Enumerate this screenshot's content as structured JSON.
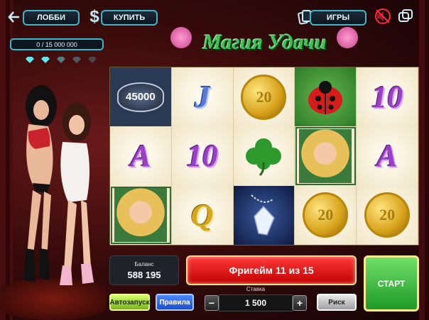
{
  "header": {
    "lobby_label": "ЛОББИ",
    "buy_label": "КУПИТЬ",
    "games_label": "ИГРЫ",
    "progress_text": "0 / 15 000 000"
  },
  "game": {
    "title": "Магия Удачи"
  },
  "reels": [
    [
      "45000",
      "J",
      "20",
      "ladybug",
      "10"
    ],
    [
      "A",
      "10",
      "clover",
      "girl",
      "A"
    ],
    [
      "girl",
      "Q",
      "crystal",
      "20",
      "20"
    ]
  ],
  "badge_sub": "DIAMONDS",
  "footer": {
    "balance_label": "Баланс",
    "balance_value": "588 195",
    "freegame_text": "Фригейм 11 из 15",
    "start_label": "СТАРТ",
    "autoplay_label": "Автозапуск",
    "rules_label": "Правила",
    "bet_label": "Ставка",
    "bet_value": "1 500",
    "minus": "−",
    "plus": "+",
    "risk_label": "Риск"
  },
  "colors": {
    "accent": "#3fb7c8",
    "start_green": "#3cc340",
    "freegame_red": "#e01010"
  }
}
